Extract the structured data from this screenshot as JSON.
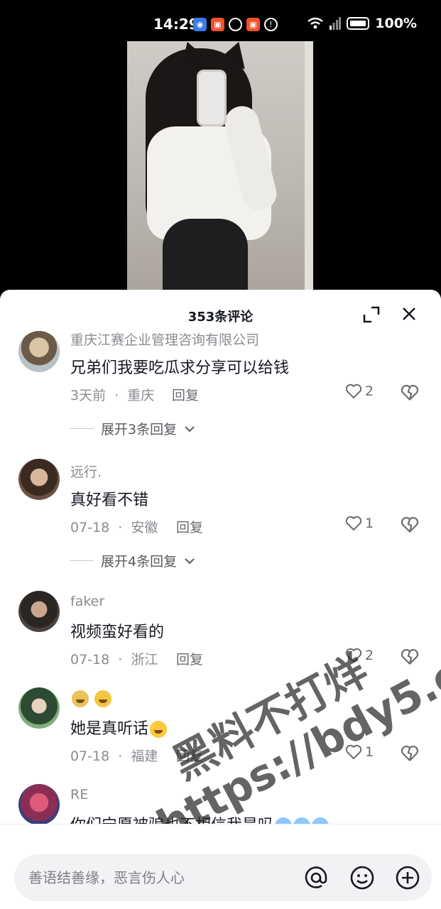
{
  "status_bar": {
    "time": "14:29",
    "battery": "100%",
    "app_icons": [
      "browser-icon",
      "app-icon",
      "hotspot-icon",
      "app-icon",
      "alert-icon"
    ]
  },
  "sheet": {
    "title": "353条评论"
  },
  "comments": [
    {
      "name": "重庆江赛企业管理咨询有限公司",
      "text": "兄弟们我要吃瓜求分享可以给钱",
      "time": "3天前",
      "location": "重庆",
      "reply": "回复",
      "likes": "2",
      "expand": "展开3条回复"
    },
    {
      "name": "远行.",
      "text": "真好看不错",
      "time": "07-18",
      "location": "安徽",
      "reply": "回复",
      "likes": "1",
      "expand": "展开4条回复"
    },
    {
      "name": "faker",
      "text": "视频蛮好看的",
      "time": "07-18",
      "location": "浙江",
      "reply": "回复",
      "likes": "2"
    },
    {
      "name": "",
      "text": "她是真听话",
      "time": "07-18",
      "location": "福建",
      "reply": "回复",
      "likes": "1"
    },
    {
      "name": "RE",
      "text": "你们宁愿被骗也不相信我是吗"
    }
  ],
  "meta_separator": "·",
  "watermark": {
    "line1": "黑料不打烊",
    "line2": "https://bdy5.co"
  },
  "input": {
    "placeholder": "善语结善缘，恶言伤人心"
  },
  "colors": {
    "accent": "#161823",
    "muted": "#8a8b91",
    "sheet_bg": "#ffffff"
  }
}
